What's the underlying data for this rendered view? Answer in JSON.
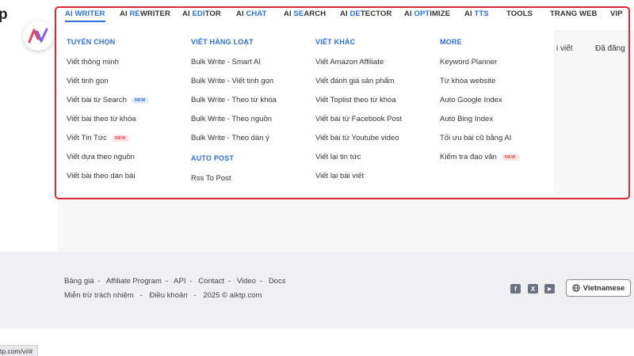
{
  "brand": {
    "logo_fragment": "p"
  },
  "nav": {
    "items": [
      {
        "prefix": "AI ",
        "highlight": "WRITER",
        "suffix": "",
        "active": true
      },
      {
        "prefix": "AI ",
        "highlight": "RE",
        "suffix": "WRITER"
      },
      {
        "prefix": "AI ",
        "highlight": "EDI",
        "suffix": "TOR"
      },
      {
        "prefix": "AI ",
        "highlight": "CHAT",
        "suffix": ""
      },
      {
        "prefix": "AI ",
        "highlight": "SE",
        "suffix": "ARCH"
      },
      {
        "prefix": "AI ",
        "highlight": "DE",
        "suffix": "TECTOR"
      },
      {
        "prefix": "AI ",
        "highlight": "OPT",
        "suffix": "IMIZE"
      },
      {
        "prefix": "AI ",
        "highlight": "TTS",
        "suffix": ""
      },
      {
        "prefix": "TOOLS",
        "highlight": "",
        "suffix": ""
      },
      {
        "prefix": "TRANG WEB",
        "highlight": "",
        "suffix": ""
      },
      {
        "prefix": "VIP",
        "highlight": "",
        "suffix": ""
      }
    ]
  },
  "background": {
    "text_1": "i viết",
    "text_2": "Đã đăng"
  },
  "mega_menu": {
    "col1": {
      "title": "TUYỂN CHỌN",
      "items": [
        "Viết thông minh",
        "Viết tinh gọn",
        "Viết bài từ Search",
        "Viết bài theo từ khóa",
        "Viết Tin Tức",
        "Viết dựa theo nguồn",
        "Viết bài theo dàn bài"
      ],
      "badges": {
        "search": "NEW",
        "tin_tuc": "NEW"
      }
    },
    "col2": {
      "title": "VIẾT HÀNG LOẠT",
      "items": [
        "Bulk Write - Smart AI",
        "Bulk Write - Viết tinh gọn",
        "Bulk Write - Theo từ khóa",
        "Bulk Write - Theo nguồn",
        "Bulk Write - Theo dàn ý"
      ],
      "sub_title": "AUTO POST",
      "sub_items": [
        "Rss To Post"
      ]
    },
    "col3": {
      "title": "VIẾT KHÁC",
      "items": [
        "Viết Amazon Affiliate",
        "Viết đánh giá sản phẩm",
        "Viết Toplist theo từ khóa",
        "Viết bài từ Facebook Post",
        "Viết bài từ Youtube video",
        "Viết lại tin tức",
        "Viết lại bài viết"
      ]
    },
    "col4": {
      "title": "MORE",
      "items": [
        "Keyword Planner",
        "Từ khóa website",
        "Auto Google Index",
        "Auto Bing Index",
        "Tối ưu bài cũ bằng AI",
        "Kiểm tra đạo văn"
      ],
      "badges": {
        "dao_van": "NEW"
      }
    }
  },
  "footer": {
    "links_row1": [
      "Bảng giá",
      "Affiliate Program",
      "API",
      "Contact",
      "Video",
      "Docs"
    ],
    "sep": "-",
    "links_row2": [
      "Miễn trừ trách nhiệm",
      "Điều khoản",
      "2025 © aiktp.com"
    ],
    "social": {
      "facebook": "f",
      "x": "X",
      "youtube": "▶"
    },
    "language": "Vietnamese"
  },
  "status_url": "tp.com/vi/#",
  "colors": {
    "accent": "#2f6fd6",
    "highlight_frame": "#dc2830",
    "new_badge_red": "#e5484d"
  }
}
